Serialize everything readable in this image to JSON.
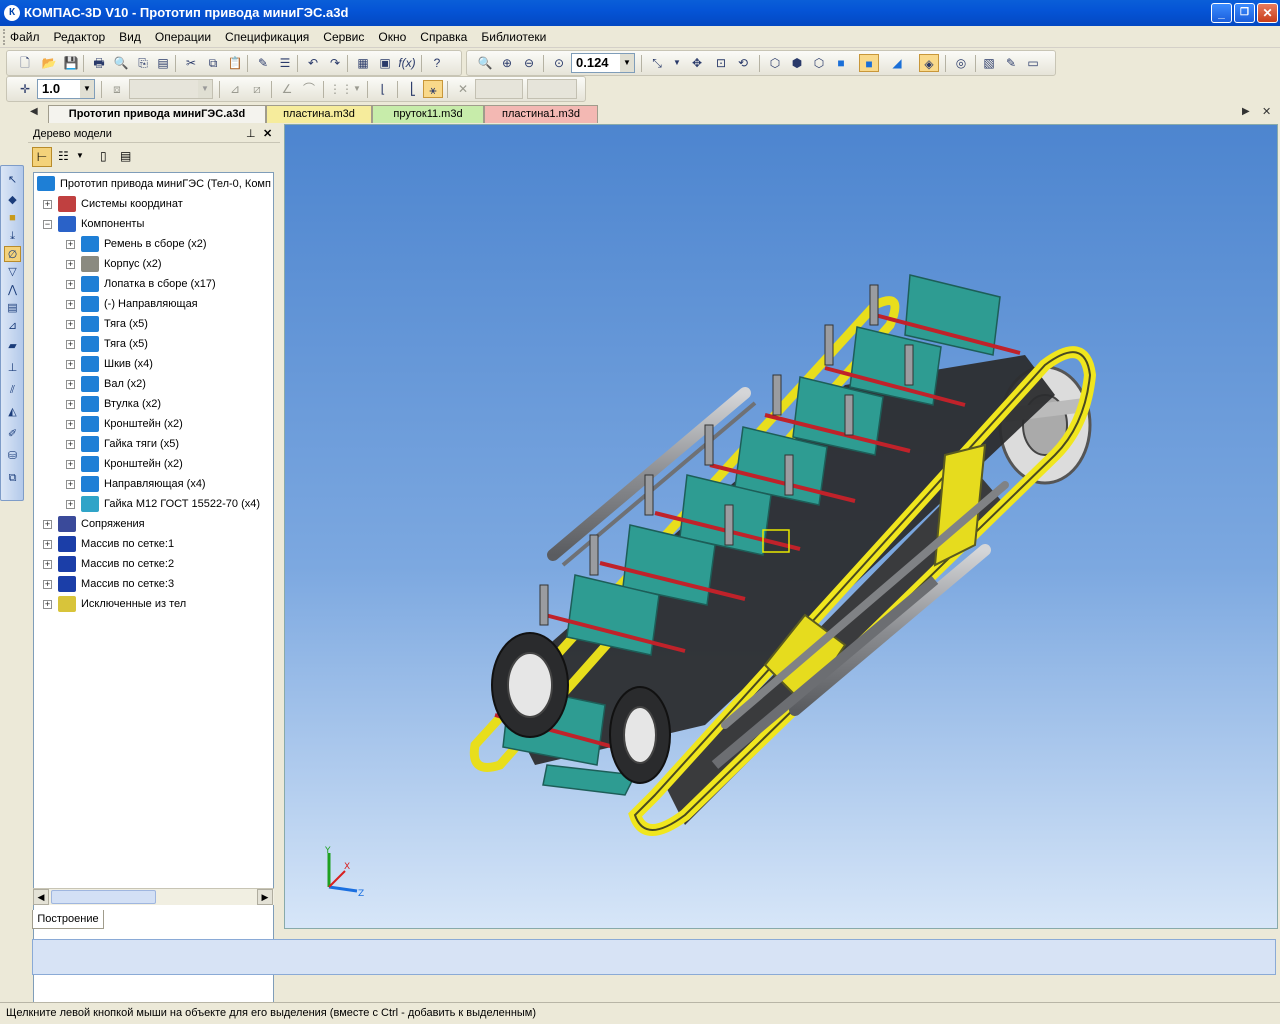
{
  "window": {
    "app_name": "КОМПАС-3D V10",
    "title": "КОМПАС-3D V10 - Прототип привода миниГЭС.a3d",
    "controls": {
      "minimize": "_",
      "restore": "❐",
      "close": "✕"
    }
  },
  "menu": [
    "Файл",
    "Редактор",
    "Вид",
    "Операции",
    "Спецификация",
    "Сервис",
    "Окно",
    "Справка",
    "Библиотеки"
  ],
  "toolbar": {
    "zoom_value": "0.124",
    "line_scale": "1.0"
  },
  "document_tabs": [
    {
      "label": "Прототип привода миниГЭС.a3d",
      "color": "#f4f3ee",
      "active": true
    },
    {
      "label": "пластина.m3d",
      "color": "#f6ec9c",
      "active": false
    },
    {
      "label": "пруток11.m3d",
      "color": "#c7ecaa",
      "active": false
    },
    {
      "label": "пластина1.m3d",
      "color": "#f3b8b3",
      "active": false
    }
  ],
  "tree_panel": {
    "title": "Дерево модели",
    "root": "Прототип привода миниГЭС (Тел-0, Комп",
    "items": [
      {
        "label": "Системы координат",
        "level": 1,
        "icon": "coordinate-system-icon",
        "color": "#c04040"
      },
      {
        "label": "Компоненты",
        "level": 1,
        "icon": "components-icon",
        "color": "#2a62c8",
        "expanded": true
      },
      {
        "label": "Ремень в сборе (x2)",
        "level": 2,
        "icon": "assembly-icon",
        "color": "#1e7fd6"
      },
      {
        "label": "Корпус (x2)",
        "level": 2,
        "icon": "part-grey-icon",
        "color": "#8a8a80"
      },
      {
        "label": "Лопатка в сборе (x17)",
        "level": 2,
        "icon": "assembly-icon",
        "color": "#1e7fd6"
      },
      {
        "label": "(-) Направляющая",
        "level": 2,
        "icon": "part-icon",
        "color": "#1e7fd6"
      },
      {
        "label": "Тяга (x5)",
        "level": 2,
        "icon": "part-icon",
        "color": "#1e7fd6"
      },
      {
        "label": "Тяга (x5)",
        "level": 2,
        "icon": "part-icon",
        "color": "#1e7fd6"
      },
      {
        "label": "Шкив (x4)",
        "level": 2,
        "icon": "part-icon",
        "color": "#1e7fd6"
      },
      {
        "label": "Вал (x2)",
        "level": 2,
        "icon": "part-icon",
        "color": "#1e7fd6"
      },
      {
        "label": "Втулка (x2)",
        "level": 2,
        "icon": "part-icon",
        "color": "#1e7fd6"
      },
      {
        "label": "Кронштейн (x2)",
        "level": 2,
        "icon": "part-icon",
        "color": "#1e7fd6"
      },
      {
        "label": "Гайка тяги (x5)",
        "level": 2,
        "icon": "part-icon",
        "color": "#1e7fd6"
      },
      {
        "label": "Кронштейн (x2)",
        "level": 2,
        "icon": "part-icon",
        "color": "#1e7fd6"
      },
      {
        "label": "Направляющая (x4)",
        "level": 2,
        "icon": "part-icon",
        "color": "#1e7fd6"
      },
      {
        "label": "Гайка М12 ГОСТ 15522-70 (x4)",
        "level": 2,
        "icon": "standard-part-icon",
        "color": "#2fa4c8"
      },
      {
        "label": "Сопряжения",
        "level": 1,
        "icon": "mates-icon",
        "color": "#3a4a9a"
      },
      {
        "label": "Массив по сетке:1",
        "level": 1,
        "icon": "grid-array-icon",
        "color": "#1b3ea8"
      },
      {
        "label": "Массив по сетке:2",
        "level": 1,
        "icon": "grid-array-icon",
        "color": "#1b3ea8"
      },
      {
        "label": "Массив по сетке:3",
        "level": 1,
        "icon": "grid-array-icon",
        "color": "#1b3ea8"
      },
      {
        "label": "Исключенные из тел",
        "level": 1,
        "icon": "excluded-icon",
        "color": "#d8c43a"
      }
    ],
    "bottom_tab": "Построение"
  },
  "axes_triad": {
    "y": "Y",
    "x": "X",
    "z": "Z"
  },
  "status": "Щелкните левой кнопкой мыши на объекте для его выделения (вместе с Ctrl - добавить к выделенным)"
}
